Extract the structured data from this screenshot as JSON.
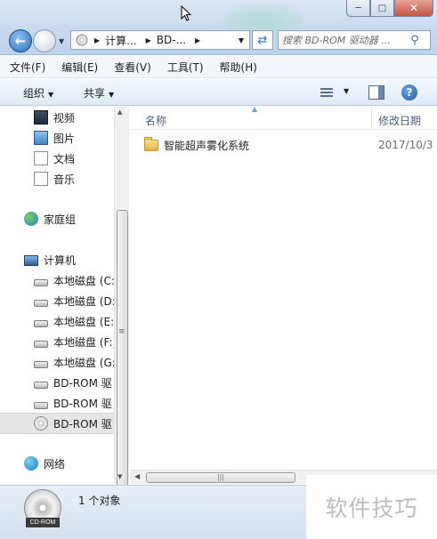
{
  "address": {
    "crumbs": [
      "计算...",
      "BD-..."
    ]
  },
  "search": {
    "placeholder": "搜索 BD-ROM 驱动器 ..."
  },
  "menubar": {
    "items": [
      "文件(F)",
      "编辑(E)",
      "查看(V)",
      "工具(T)",
      "帮助(H)"
    ]
  },
  "commandbar": {
    "organize": "组织",
    "share": "共享"
  },
  "navpane": {
    "libraries": [
      "视频",
      "图片",
      "文档",
      "音乐"
    ],
    "homegroup": "家庭组",
    "computer": "计算机",
    "drives": [
      "本地磁盘 (C:",
      "本地磁盘 (D:",
      "本地磁盘 (E:)",
      "本地磁盘 (F:)",
      "本地磁盘 (G:",
      "BD-ROM 驱",
      "BD-ROM 驱",
      "BD-ROM 驱"
    ],
    "network": "网络"
  },
  "content": {
    "columns": {
      "name": "名称",
      "date": "修改日期"
    },
    "files": [
      {
        "name": "智能超声雾化系统",
        "date": "2017/10/3"
      }
    ]
  },
  "status": {
    "icon_label": "CD-ROM",
    "text": "1 个对象"
  },
  "watermark": "软件技巧"
}
